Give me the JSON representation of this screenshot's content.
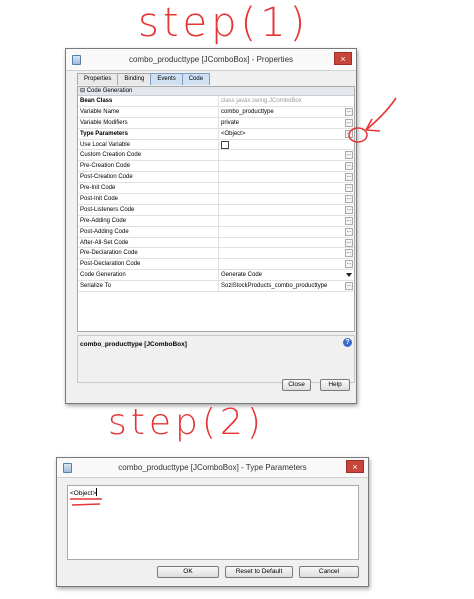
{
  "annotations": {
    "step1": "step(1)",
    "step2": "step(2)"
  },
  "colors": {
    "annotation_red": "#e53535",
    "close_red": "#c7453b",
    "active_tab": "#cfe0f3",
    "help_blue": "#3a6bc7"
  },
  "dialog1": {
    "title": "combo_producttype [JComboBox] - Properties",
    "close_icon": "×",
    "tabs": [
      {
        "label": "Properties",
        "active": false
      },
      {
        "label": "Binding",
        "active": false
      },
      {
        "label": "Events",
        "active": true
      },
      {
        "label": "Code",
        "active": true
      }
    ],
    "section_header": "⊟ Code Generation",
    "properties": [
      {
        "name": "Bean Class",
        "value": "class javax.swing.JComboBox",
        "bold": true,
        "gray": true,
        "ellipsis": false
      },
      {
        "name": "Variable Name",
        "value": "combo_producttype",
        "bold": false,
        "ellipsis": true
      },
      {
        "name": "Variable Modifiers",
        "value": "private",
        "bold": false,
        "ellipsis": true
      },
      {
        "name": "Type Parameters",
        "value": "<Object>",
        "bold": true,
        "ellipsis": true
      },
      {
        "name": "Use Local Variable",
        "value": "",
        "bold": false,
        "checkbox": true,
        "ellipsis": false
      },
      {
        "name": "Custom Creation Code",
        "value": "",
        "bold": false,
        "ellipsis": true
      },
      {
        "name": "Pre-Creation Code",
        "value": "",
        "bold": false,
        "ellipsis": true
      },
      {
        "name": "Post-Creation Code",
        "value": "",
        "bold": false,
        "ellipsis": true
      },
      {
        "name": "Pre-Init Code",
        "value": "",
        "bold": false,
        "ellipsis": true
      },
      {
        "name": "Post-Init Code",
        "value": "",
        "bold": false,
        "ellipsis": true
      },
      {
        "name": "Post-Listeners Code",
        "value": "",
        "bold": false,
        "ellipsis": true
      },
      {
        "name": "Pre-Adding Code",
        "value": "",
        "bold": false,
        "ellipsis": true
      },
      {
        "name": "Post-Adding Code",
        "value": "",
        "bold": false,
        "ellipsis": true
      },
      {
        "name": "After-All-Set Code",
        "value": "",
        "bold": false,
        "ellipsis": true
      },
      {
        "name": "Pre-Declaration Code",
        "value": "",
        "bold": false,
        "ellipsis": true
      },
      {
        "name": "Post-Declaration Code",
        "value": "",
        "bold": false,
        "ellipsis": true
      },
      {
        "name": "Code Generation",
        "value": "Generate Code",
        "bold": false,
        "dropdown": true
      },
      {
        "name": "Serialize To",
        "value": "SoziStockProducts_combo_producttype",
        "bold": false,
        "ellipsis": true
      }
    ],
    "ellipsis_label": "...",
    "description": "combo_producttype [JComboBox]",
    "help_icon": "?",
    "buttons": {
      "close": "Close",
      "help": "Help"
    }
  },
  "dialog2": {
    "title": "combo_producttype [JComboBox] - Type Parameters",
    "close_icon": "×",
    "text_value": "<Object>",
    "buttons": {
      "ok": "OK",
      "reset": "Reset to Default",
      "cancel": "Cancel"
    }
  }
}
